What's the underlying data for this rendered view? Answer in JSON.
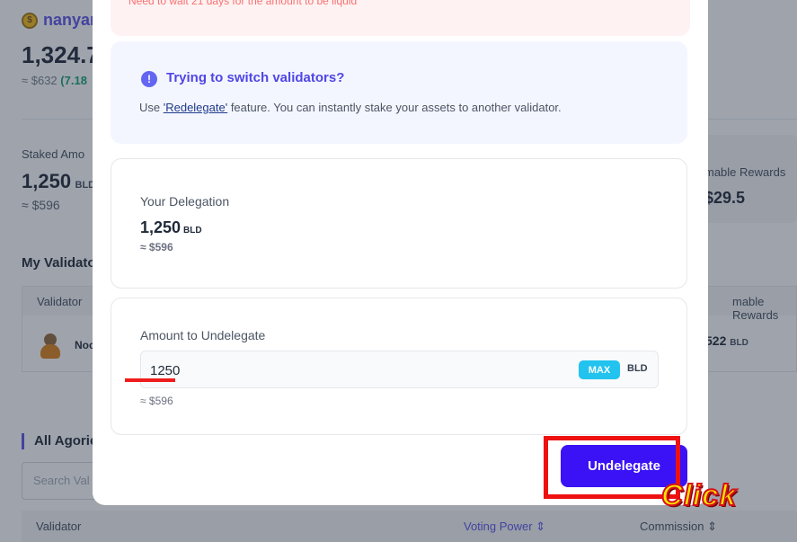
{
  "background": {
    "account_name": "nanyar",
    "balance": "1,324.7",
    "balance_usd": "≈ $632",
    "balance_change": "(7.18",
    "staked_label": "Staked Amo",
    "staked_value": "1,250",
    "staked_unit": "BLD",
    "staked_usd": "≈ $596",
    "claimable_label": "mable Rewards",
    "claimable_value": "$29.5",
    "my_validators_title": "My Validato",
    "table_validator_header": "Validator",
    "table_claimable_header": "mable Rewards",
    "validator_name": "Noc",
    "validator_rewards": "522",
    "validator_rewards_unit": "BLD",
    "all_validators_title": "All Agoric",
    "search_placeholder": "Search Val",
    "table2_validator": "Validator",
    "table2_voting_power": "Voting Power ⇕",
    "table2_commission": "Commission ⇕"
  },
  "modal": {
    "warning_text": "Need to wait 21 days for the amount to be liquid",
    "info": {
      "icon": "exclamation-icon",
      "title": "Trying to switch validators?",
      "desc_prefix": "Use ",
      "desc_link": "'Redelegate'",
      "desc_suffix": " feature. You can instantly stake your assets to another validator."
    },
    "delegation": {
      "label": "Your Delegation",
      "value": "1,250",
      "unit": "BLD",
      "usd": "≈ $596"
    },
    "amount": {
      "label": "Amount to Undelegate",
      "value": "1250",
      "max_label": "MAX",
      "unit": "BLD",
      "usd": "≈ $596"
    },
    "submit_label": "Undelegate"
  },
  "annotation": {
    "click_label": "Click",
    "highlight_color": "#ee1111",
    "click_color": "#ffe600"
  },
  "colors": {
    "brand": "#4f46e5",
    "button": "#3b12f5",
    "max": "#22c3ee"
  }
}
